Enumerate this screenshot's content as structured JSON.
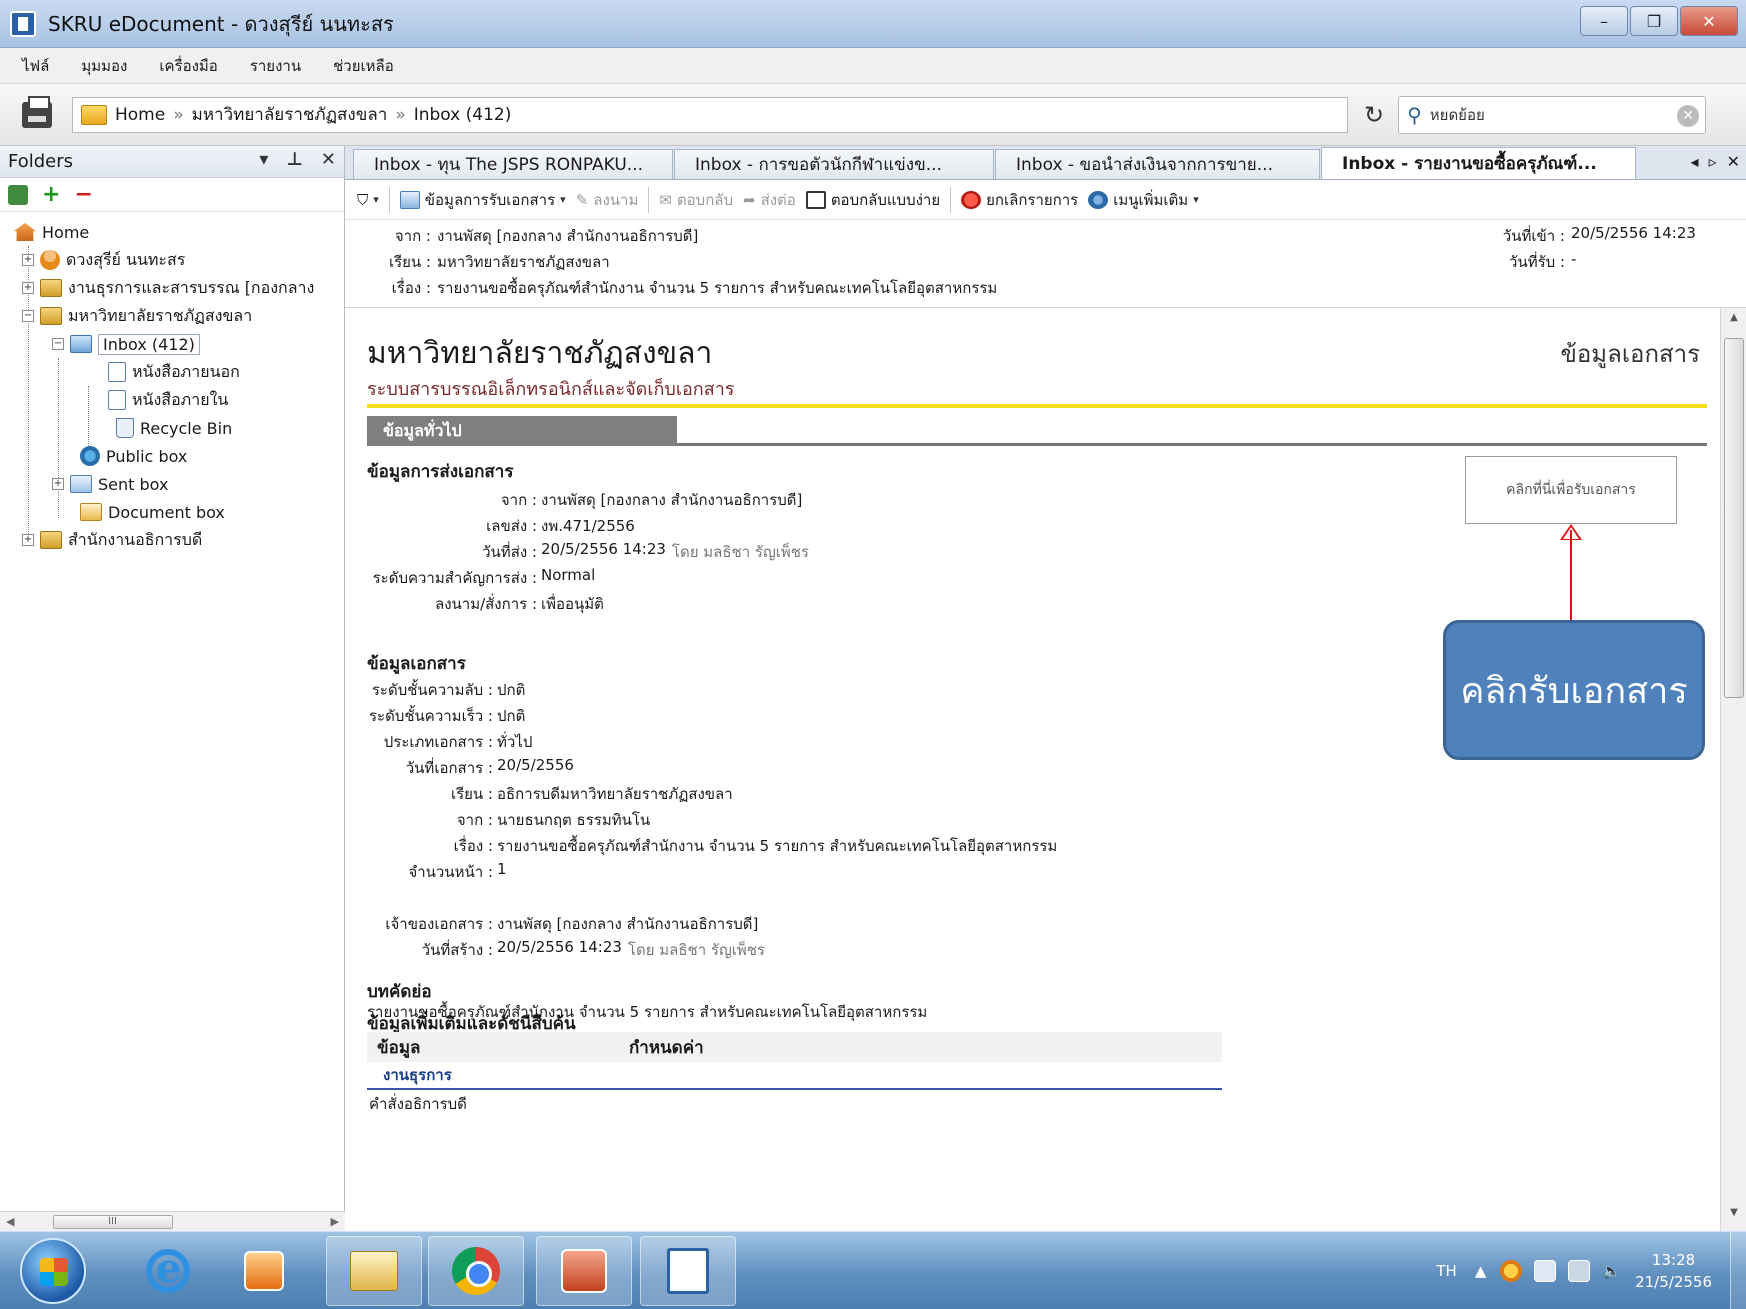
{
  "window": {
    "title": "SKRU eDocument - ดวงสุรีย์ นนทะสร",
    "controls": [
      "minimize",
      "maximize",
      "close"
    ]
  },
  "menu": [
    "ไฟล์",
    "มุมมอง",
    "เครื่องมือ",
    "รายงาน",
    "ช่วยเหลือ"
  ],
  "address": {
    "crumbs": [
      "Home",
      "มหาวิทยาลัยราชภัฏสงขลา",
      "Inbox (412)"
    ],
    "separator": "»",
    "search_placeholder": "หยดย้อย"
  },
  "folders": {
    "title": "Folders",
    "tree": [
      {
        "label": "Home",
        "icon": "home-icon"
      },
      {
        "label": "ดวงสุรีย์ นนทะสร",
        "icon": "user-icon"
      },
      {
        "label": "งานธุรการและสารบรรณ [กองกลาง",
        "icon": "cabinet-icon"
      },
      {
        "label": "มหาวิทยาลัยราชภัฏสงขลา",
        "icon": "cabinet-icon"
      },
      {
        "label": "Inbox (412)",
        "icon": "inbox-icon"
      },
      {
        "label": "หนังสือภายนอก",
        "icon": "document-icon"
      },
      {
        "label": "หนังสือภายใน",
        "icon": "document-icon"
      },
      {
        "label": "Recycle Bin",
        "icon": "recycle-bin-icon"
      },
      {
        "label": "Public box",
        "icon": "public-box-icon"
      },
      {
        "label": "Sent box",
        "icon": "sent-box-icon"
      },
      {
        "label": "Document box",
        "icon": "document-box-icon"
      },
      {
        "label": "สำนักงานอธิการบดี",
        "icon": "cabinet-icon"
      }
    ],
    "hscroll_thumb": "III"
  },
  "tabs": [
    {
      "label": "Inbox - ทุน The JSPS RONPAKU...",
      "active": false
    },
    {
      "label": "Inbox - การขอตัวนักกีฬาแข่งข...",
      "active": false
    },
    {
      "label": "Inbox - ขอนำส่งเงินจากการขาย...",
      "active": false
    },
    {
      "label": "Inbox - รายงานขอซื้อครุภัณฑ์...",
      "active": true
    }
  ],
  "toolbar": {
    "receive_info": "ข้อมูลการรับเอกสาร",
    "sign": "ลงนาม",
    "reply": "ตอบกลับ",
    "forward": "ส่งต่อ",
    "reply_simple": "ตอบกลับแบบง่าย",
    "cancel_item": "ยกเลิกรายการ",
    "more_menu": "เมนูเพิ่มเติม"
  },
  "message_header": {
    "from_label": "จาก :",
    "from": "งานพัสดุ [กองกลาง สำนักงานอธิการบดี]",
    "to_label": "เรียน :",
    "to": "มหาวิทยาลัยราชภัฏสงขลา",
    "subject_label": "เรื่อง :",
    "subject": "รายงานขอซื้อครุภัณฑ์สำนักงาน จำนวน 5 รายการ สำหรับคณะเทคโนโลยีอุตสาหกรรม",
    "date_in_label": "วันที่เข้า :",
    "date_in": "20/5/2556 14:23",
    "date_received_label": "วันที่รับ :",
    "date_received": "-"
  },
  "content": {
    "org_title": "มหาวิทยาลัยราชภัฏสงขลา",
    "system_subtitle": "ระบบสารบรรณอิเล็กทรอนิกส์และจัดเก็บเอกสาร",
    "right_title": "ข้อมูลเอกสาร",
    "section_tab": "ข้อมูลทั่วไป",
    "send_heading": "ข้อมูลการส่งเอกสาร",
    "send": [
      {
        "k": "จาก :",
        "v": "งานพัสดุ [กองกลาง สำนักงานอธิการบดี]"
      },
      {
        "k": "เลขส่ง :",
        "v": "งพ.471/2556"
      },
      {
        "k": "วันที่ส่ง :",
        "v": "20/5/2556 14:23",
        "extra": "โดย มลธิชา รัญเพ็ชร"
      },
      {
        "k": "ระดับความสำคัญการส่ง :",
        "v": "Normal"
      },
      {
        "k": "ลงนาม/สั่งการ :",
        "v": "เพื่ออนุมัติ"
      }
    ],
    "doc_heading": "ข้อมูลเอกสาร",
    "doc": [
      {
        "k": "ระดับชั้นความลับ :",
        "v": "ปกติ"
      },
      {
        "k": "ระดับชั้นความเร็ว :",
        "v": "ปกติ"
      },
      {
        "k": "ประเภทเอกสาร :",
        "v": "ทั่วไป"
      },
      {
        "k": "วันที่เอกสาร :",
        "v": "20/5/2556"
      },
      {
        "k": "เรียน :",
        "v": "อธิการบดีมหาวิทยาลัยราชภัฏสงขลา"
      },
      {
        "k": "จาก :",
        "v": "นายธนกฤต ธรรมทินโน"
      },
      {
        "k": "เรื่อง :",
        "v": "รายงานขอซื้อครุภัณฑ์สำนักงาน จำนวน 5 รายการ สำหรับคณะเทคโนโลยีอุตสาหกรรม"
      },
      {
        "k": "จำนวนหน้า :",
        "v": "1"
      }
    ],
    "owner": [
      {
        "k": "เจ้าของเอกสาร :",
        "v": "งานพัสดุ [กองกลาง สำนักงานอธิการบดี]"
      },
      {
        "k": "วันที่สร้าง :",
        "v": "20/5/2556 14:23",
        "extra": "โดย มลธิชา รัญเพ็ชร"
      }
    ],
    "abstract_heading": "บทคัดย่อ",
    "abstract": "รายงานขอซื้อครุภัณฑ์สำนักงาน จำนวน 5 รายการ สำหรับคณะเทคโนโลยีอุตสาหกรรม",
    "meta_heading": "ข้อมูลเพิ่มเติมและดัชนีสืบค้น",
    "meta_cols": [
      "ข้อมูล",
      "กำหนดค่า"
    ],
    "meta_group": "งานธุรการ",
    "meta_row": "คำสั่งอธิการบดี",
    "receive_button": "คลิกที่นี่เพื่อรับเอกสาร",
    "callout": "คลิกรับเอกสาร"
  },
  "taskbar": {
    "lang": "TH",
    "time": "13:28",
    "date": "21/5/2556"
  }
}
